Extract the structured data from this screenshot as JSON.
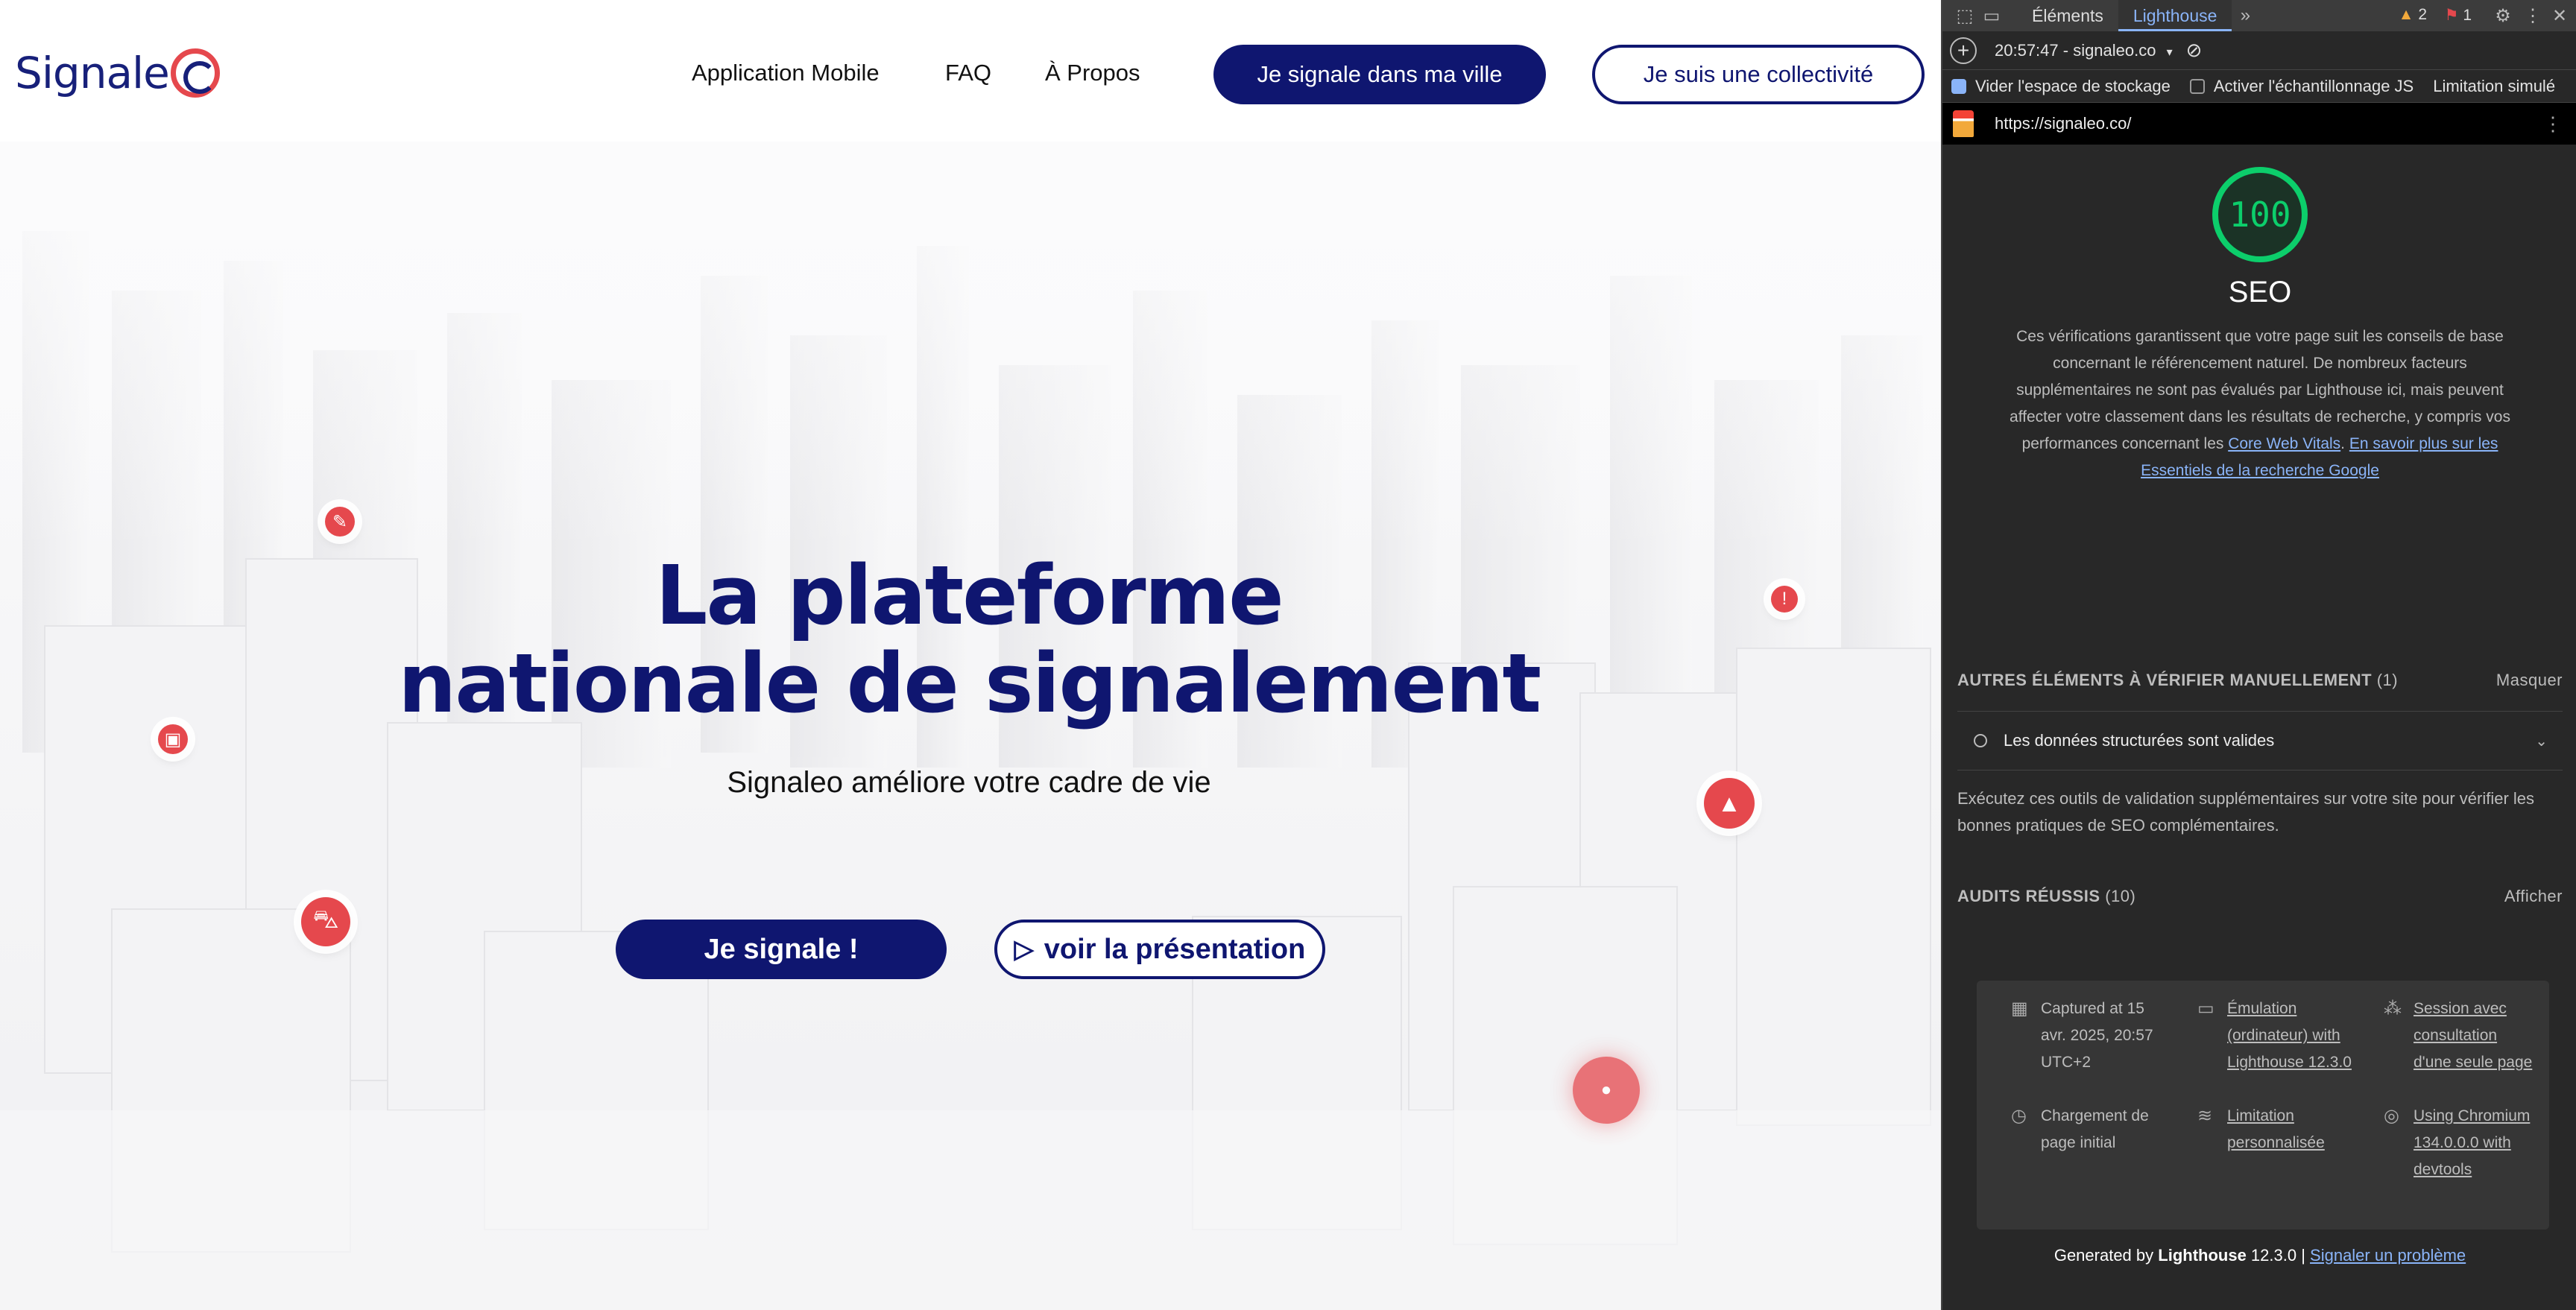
{
  "site": {
    "logo_text": "Signale",
    "nav": [
      "Application Mobile",
      "FAQ",
      "À Propos"
    ],
    "cta_city": "Je signale dans ma ville",
    "cta_collectivity": "Je suis une collectivité",
    "hero_title_line1": "La plateforme",
    "hero_title_line2": "nationale de signalement",
    "hero_subtitle": "Signaleo améliore votre cadre de vie",
    "btn_report": "Je signale !",
    "btn_presentation": "voir la présentation",
    "colors": {
      "brand_navy": "#0f1670",
      "accent_red": "#e5484d"
    }
  },
  "devtools": {
    "tabs": [
      "Éléments",
      "Lighthouse"
    ],
    "active_tab": "Lighthouse",
    "warnings_count": "2",
    "errors_count": "1",
    "report_selector": "20:57:47 - signaleo.co",
    "options": [
      "Vider l'espace de stockage",
      "Activer l'échantillonnage JS",
      "Limitation simulé"
    ],
    "url": "https://signaleo.co/",
    "score": "100",
    "category": "SEO",
    "description": "Ces vérifications garantissent que votre page suit les conseils de base concernant le référencement naturel. De nombreux facteurs supplémentaires ne sont pas évalués par Lighthouse ici, mais peuvent affecter votre classement dans les résultats de recherche, y compris vos performances concernant les ",
    "link_cwv": "Core Web Vitals",
    "link_learn_more": "En savoir plus sur les Essentiels de la recherche Google",
    "manual_section_title": "AUTRES ÉLÉMENTS À VÉRIFIER MANUELLEMENT",
    "manual_count": "(1)",
    "manual_toggle": "Masquer",
    "manual_item": "Les données structurées sont valides",
    "manual_desc": "Exécutez ces outils de validation supplémentaires sur votre site pour vérifier les bonnes pratiques de SEO complémentaires.",
    "passed_title": "AUDITS RÉUSSIS",
    "passed_count": "(10)",
    "passed_toggle": "Afficher",
    "env": {
      "captured": "Captured at 15 avr. 2025, 20:57 UTC+2",
      "emulation": "Émulation (ordinateur) with Lighthouse 12.3.0",
      "session": "Session avec consultation d'une seule page",
      "load": "Chargement de page initial",
      "throttling": "Limitation personnalisée",
      "browser": "Using Chromium 134.0.0.0 with devtools"
    },
    "footer_prefix": "Generated by ",
    "footer_brand": "Lighthouse",
    "footer_version": " 12.3.0 | ",
    "footer_link": "Signaler un problème",
    "colors": {
      "score_green": "#0cce6b",
      "link_blue": "#8ab4f8"
    }
  }
}
